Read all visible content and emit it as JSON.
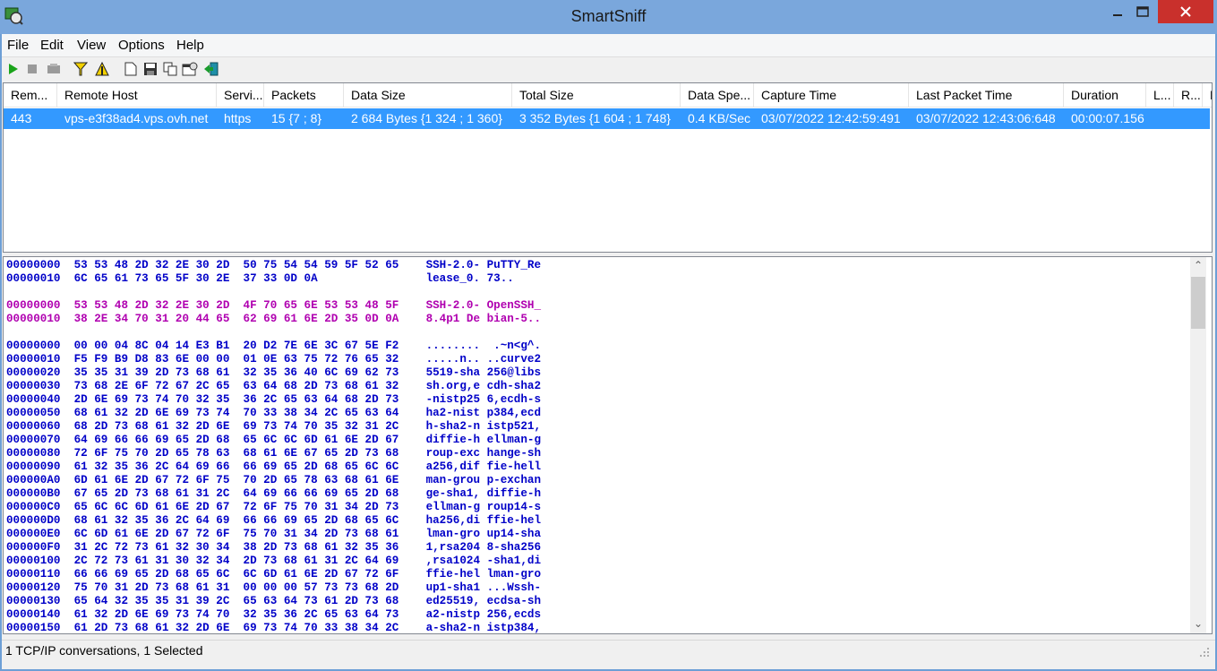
{
  "window": {
    "title": "SmartSniff"
  },
  "menu": [
    "File",
    "Edit",
    "View",
    "Options",
    "Help"
  ],
  "toolbar": {
    "icons": [
      "start-capture-icon",
      "stop-capture-icon",
      "pause-icon",
      "filter-icon",
      "display-filter-icon",
      "new-icon",
      "save-icon",
      "copy-icon",
      "properties-icon",
      "exit-icon"
    ]
  },
  "table": {
    "columns": [
      "Rem...",
      "Remote Host",
      "Servi...",
      "Packets",
      "Data Size",
      "Total Size",
      "Data Spe...",
      "Capture Time",
      "Last Packet Time",
      "Duration",
      "L...",
      "R...",
      "L"
    ],
    "rows": [
      [
        "443",
        "vps-e3f38ad4.vps.ovh.net",
        "https",
        "15  {7 ; 8}",
        "2 684 Bytes  {1 324 ; 1 360}",
        "3 352 Bytes  {1 604 ; 1 748}",
        "0.4 KB/Sec",
        "03/07/2022 12:42:59:491",
        "03/07/2022 12:43:06:648",
        "00:00:07.156"
      ]
    ]
  },
  "hex": {
    "lines": [
      {
        "t": "00000000  53 53 48 2D 32 2E 30 2D  50 75 54 54 59 5F 52 65    SSH-2.0- PuTTY_Re",
        "c": "blue"
      },
      {
        "t": "00000010  6C 65 61 73 65 5F 30 2E  37 33 0D 0A                lease_0. 73..",
        "c": "blue"
      },
      {
        "t": "",
        "c": "blue"
      },
      {
        "t": "00000000  53 53 48 2D 32 2E 30 2D  4F 70 65 6E 53 53 48 5F    SSH-2.0- OpenSSH_",
        "c": "purple"
      },
      {
        "t": "00000010  38 2E 34 70 31 20 44 65  62 69 61 6E 2D 35 0D 0A    8.4p1 De bian-5..",
        "c": "purple"
      },
      {
        "t": "",
        "c": "blue"
      },
      {
        "t": "00000000  00 00 04 8C 04 14 E3 B1  20 D2 7E 6E 3C 67 5E F2    ........  .~n<g^.",
        "c": "blue"
      },
      {
        "t": "00000010  F5 F9 B9 D8 83 6E 00 00  01 0E 63 75 72 76 65 32    .....n.. ..curve2",
        "c": "blue"
      },
      {
        "t": "00000020  35 35 31 39 2D 73 68 61  32 35 36 40 6C 69 62 73    5519-sha 256@libs",
        "c": "blue"
      },
      {
        "t": "00000030  73 68 2E 6F 72 67 2C 65  63 64 68 2D 73 68 61 32    sh.org,e cdh-sha2",
        "c": "blue"
      },
      {
        "t": "00000040  2D 6E 69 73 74 70 32 35  36 2C 65 63 64 68 2D 73    -nistp25 6,ecdh-s",
        "c": "blue"
      },
      {
        "t": "00000050  68 61 32 2D 6E 69 73 74  70 33 38 34 2C 65 63 64    ha2-nist p384,ecd",
        "c": "blue"
      },
      {
        "t": "00000060  68 2D 73 68 61 32 2D 6E  69 73 74 70 35 32 31 2C    h-sha2-n istp521,",
        "c": "blue"
      },
      {
        "t": "00000070  64 69 66 66 69 65 2D 68  65 6C 6C 6D 61 6E 2D 67    diffie-h ellman-g",
        "c": "blue"
      },
      {
        "t": "00000080  72 6F 75 70 2D 65 78 63  68 61 6E 67 65 2D 73 68    roup-exc hange-sh",
        "c": "blue"
      },
      {
        "t": "00000090  61 32 35 36 2C 64 69 66  66 69 65 2D 68 65 6C 6C    a256,dif fie-hell",
        "c": "blue"
      },
      {
        "t": "000000A0  6D 61 6E 2D 67 72 6F 75  70 2D 65 78 63 68 61 6E    man-grou p-exchan",
        "c": "blue"
      },
      {
        "t": "000000B0  67 65 2D 73 68 61 31 2C  64 69 66 66 69 65 2D 68    ge-sha1, diffie-h",
        "c": "blue"
      },
      {
        "t": "000000C0  65 6C 6C 6D 61 6E 2D 67  72 6F 75 70 31 34 2D 73    ellman-g roup14-s",
        "c": "blue"
      },
      {
        "t": "000000D0  68 61 32 35 36 2C 64 69  66 66 69 65 2D 68 65 6C    ha256,di ffie-hel",
        "c": "blue"
      },
      {
        "t": "000000E0  6C 6D 61 6E 2D 67 72 6F  75 70 31 34 2D 73 68 61    lman-gro up14-sha",
        "c": "blue"
      },
      {
        "t": "000000F0  31 2C 72 73 61 32 30 34  38 2D 73 68 61 32 35 36    1,rsa204 8-sha256",
        "c": "blue"
      },
      {
        "t": "00000100  2C 72 73 61 31 30 32 34  2D 73 68 61 31 2C 64 69    ,rsa1024 -sha1,di",
        "c": "blue"
      },
      {
        "t": "00000110  66 66 69 65 2D 68 65 6C  6C 6D 61 6E 2D 67 72 6F    ffie-hel lman-gro",
        "c": "blue"
      },
      {
        "t": "00000120  75 70 31 2D 73 68 61 31  00 00 00 57 73 73 68 2D    up1-sha1 ...Wssh-",
        "c": "blue"
      },
      {
        "t": "00000130  65 64 32 35 35 31 39 2C  65 63 64 73 61 2D 73 68    ed25519, ecdsa-sh",
        "c": "blue"
      },
      {
        "t": "00000140  61 32 2D 6E 69 73 74 70  32 35 36 2C 65 63 64 73    a2-nistp 256,ecds",
        "c": "blue"
      },
      {
        "t": "00000150  61 2D 73 68 61 32 2D 6E  69 73 74 70 33 38 34 2C    a-sha2-n istp384,",
        "c": "blue"
      }
    ]
  },
  "status": {
    "text": "1 TCP/IP conversations, 1 Selected"
  },
  "colors": {
    "selection": "#3399ff",
    "hex_blue": "#0000c8",
    "hex_purple": "#b000b0"
  }
}
